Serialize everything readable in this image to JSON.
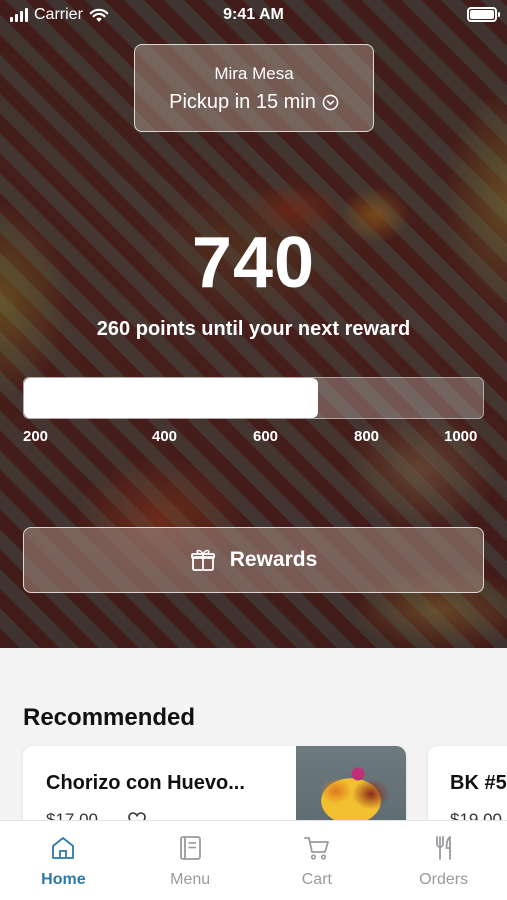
{
  "status_bar": {
    "carrier": "Carrier",
    "time": "9:41 AM"
  },
  "location": {
    "name": "Mira Mesa",
    "pickup": "Pickup in 15 min"
  },
  "points": {
    "value": "740",
    "caption": "260 points until your next reward",
    "progress_fraction": 0.64,
    "ticks": [
      "200",
      "400",
      "600",
      "800",
      "1000"
    ]
  },
  "rewards_button": {
    "label": "Rewards",
    "icon": "gift-icon"
  },
  "recommended": {
    "title": "Recommended",
    "items": [
      {
        "name": "Chorizo con Huevo...",
        "price": "$17.00",
        "favorite_icon": "heart-icon"
      },
      {
        "name": "BK #5",
        "price": "$19.00"
      }
    ]
  },
  "tabs": [
    {
      "label": "Home",
      "icon": "home-icon",
      "active": true
    },
    {
      "label": "Menu",
      "icon": "menu-book-icon",
      "active": false
    },
    {
      "label": "Cart",
      "icon": "cart-icon",
      "active": false
    },
    {
      "label": "Orders",
      "icon": "fork-knife-icon",
      "active": false
    }
  ],
  "colors": {
    "accent": "#2b7aa8",
    "inactive_tab": "#9a9a9f"
  }
}
